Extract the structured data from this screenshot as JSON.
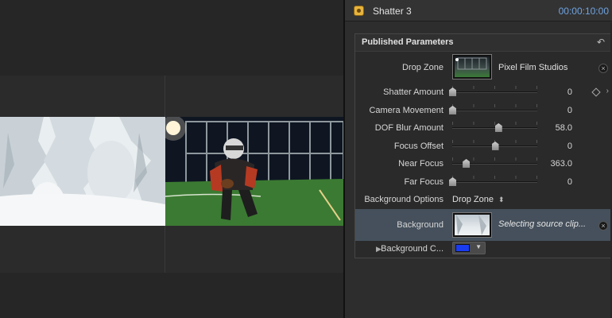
{
  "inspector": {
    "title": "Shatter 3",
    "timecode": "00:00:10:00"
  },
  "section": {
    "title": "Published Parameters",
    "undo_icon": "↶"
  },
  "drop_zone": {
    "label": "Drop Zone",
    "source_name": "Pixel Film Studios"
  },
  "params": [
    {
      "label": "Shatter Amount",
      "value": "0",
      "fraction": 0.0
    },
    {
      "label": "Camera Movement",
      "value": "0",
      "fraction": 0.0
    },
    {
      "label": "DOF Blur Amount",
      "value": "58.0",
      "fraction": 0.54
    },
    {
      "label": "Focus Offset",
      "value": "0",
      "fraction": 0.5
    },
    {
      "label": "Near Focus",
      "value": "363.0",
      "fraction": 0.16
    },
    {
      "label": "Far Focus",
      "value": "0",
      "fraction": 0.0
    }
  ],
  "bg_options": {
    "label": "Background Options",
    "value": "Drop Zone",
    "arrows": "⬍"
  },
  "background": {
    "label": "Background",
    "status": "Selecting source clip..."
  },
  "bg_color": {
    "label": "Background C...",
    "disclosure": "▶",
    "swatch_color": "#1a3cf0",
    "arrow": "▼"
  },
  "icons": {
    "clear": "×",
    "chevron": "›"
  }
}
